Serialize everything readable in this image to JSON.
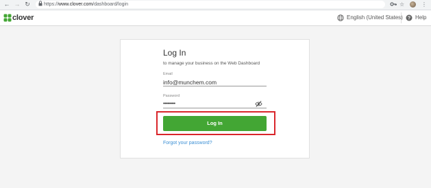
{
  "browser": {
    "url_scheme": "https://",
    "url_host": "www.clover.com",
    "url_path": "/dashboard/login",
    "back_icon": "arrow-left-icon",
    "forward_icon": "arrow-right-icon",
    "reload_icon": "reload-icon",
    "lock_icon": "lock-icon",
    "key_icon": "key-icon",
    "star_icon": "star-icon",
    "menu_icon": "vertical-dots-icon"
  },
  "header": {
    "logo_text": "clover",
    "language": "English (United States)",
    "help": "Help",
    "colors": {
      "logo_green": "#43a634"
    }
  },
  "login": {
    "title": "Log In",
    "subtitle": "to manage your business on the Web Dashboard",
    "email_label": "Email",
    "email_value": "info@munchem.com",
    "password_label": "Password",
    "password_value": "•••••••••",
    "button_label": "Log In",
    "forgot_link": "Forgot your password?",
    "colors": {
      "button": "#43a634",
      "link": "#3b8fd4",
      "highlight": "#d9252a"
    }
  }
}
